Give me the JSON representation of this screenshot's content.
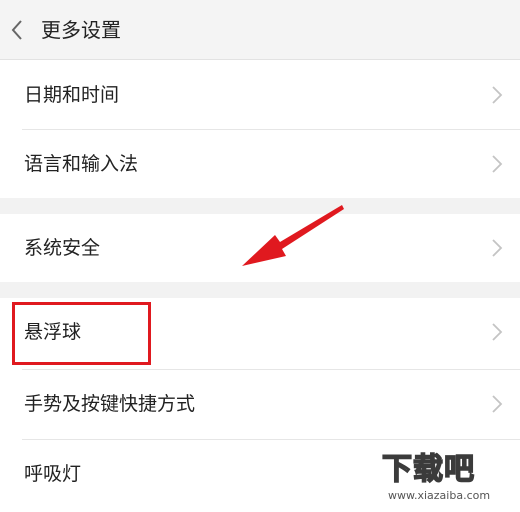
{
  "header": {
    "title": "更多设置",
    "back_icon": "chevron-left-icon"
  },
  "menu": {
    "items": [
      {
        "label": "日期和时间"
      },
      {
        "label": "语言和输入法"
      },
      {
        "label": "系统安全"
      },
      {
        "label": "悬浮球"
      },
      {
        "label": "手势及按键快捷方式"
      },
      {
        "label": "呼吸灯"
      }
    ],
    "chevron_icon": "chevron-right-icon"
  },
  "annotation": {
    "highlight_color": "#e0191f",
    "arrow_color": "#e0191f"
  },
  "watermark": {
    "text": "下载吧",
    "url": "www.xiazaiba.com"
  }
}
